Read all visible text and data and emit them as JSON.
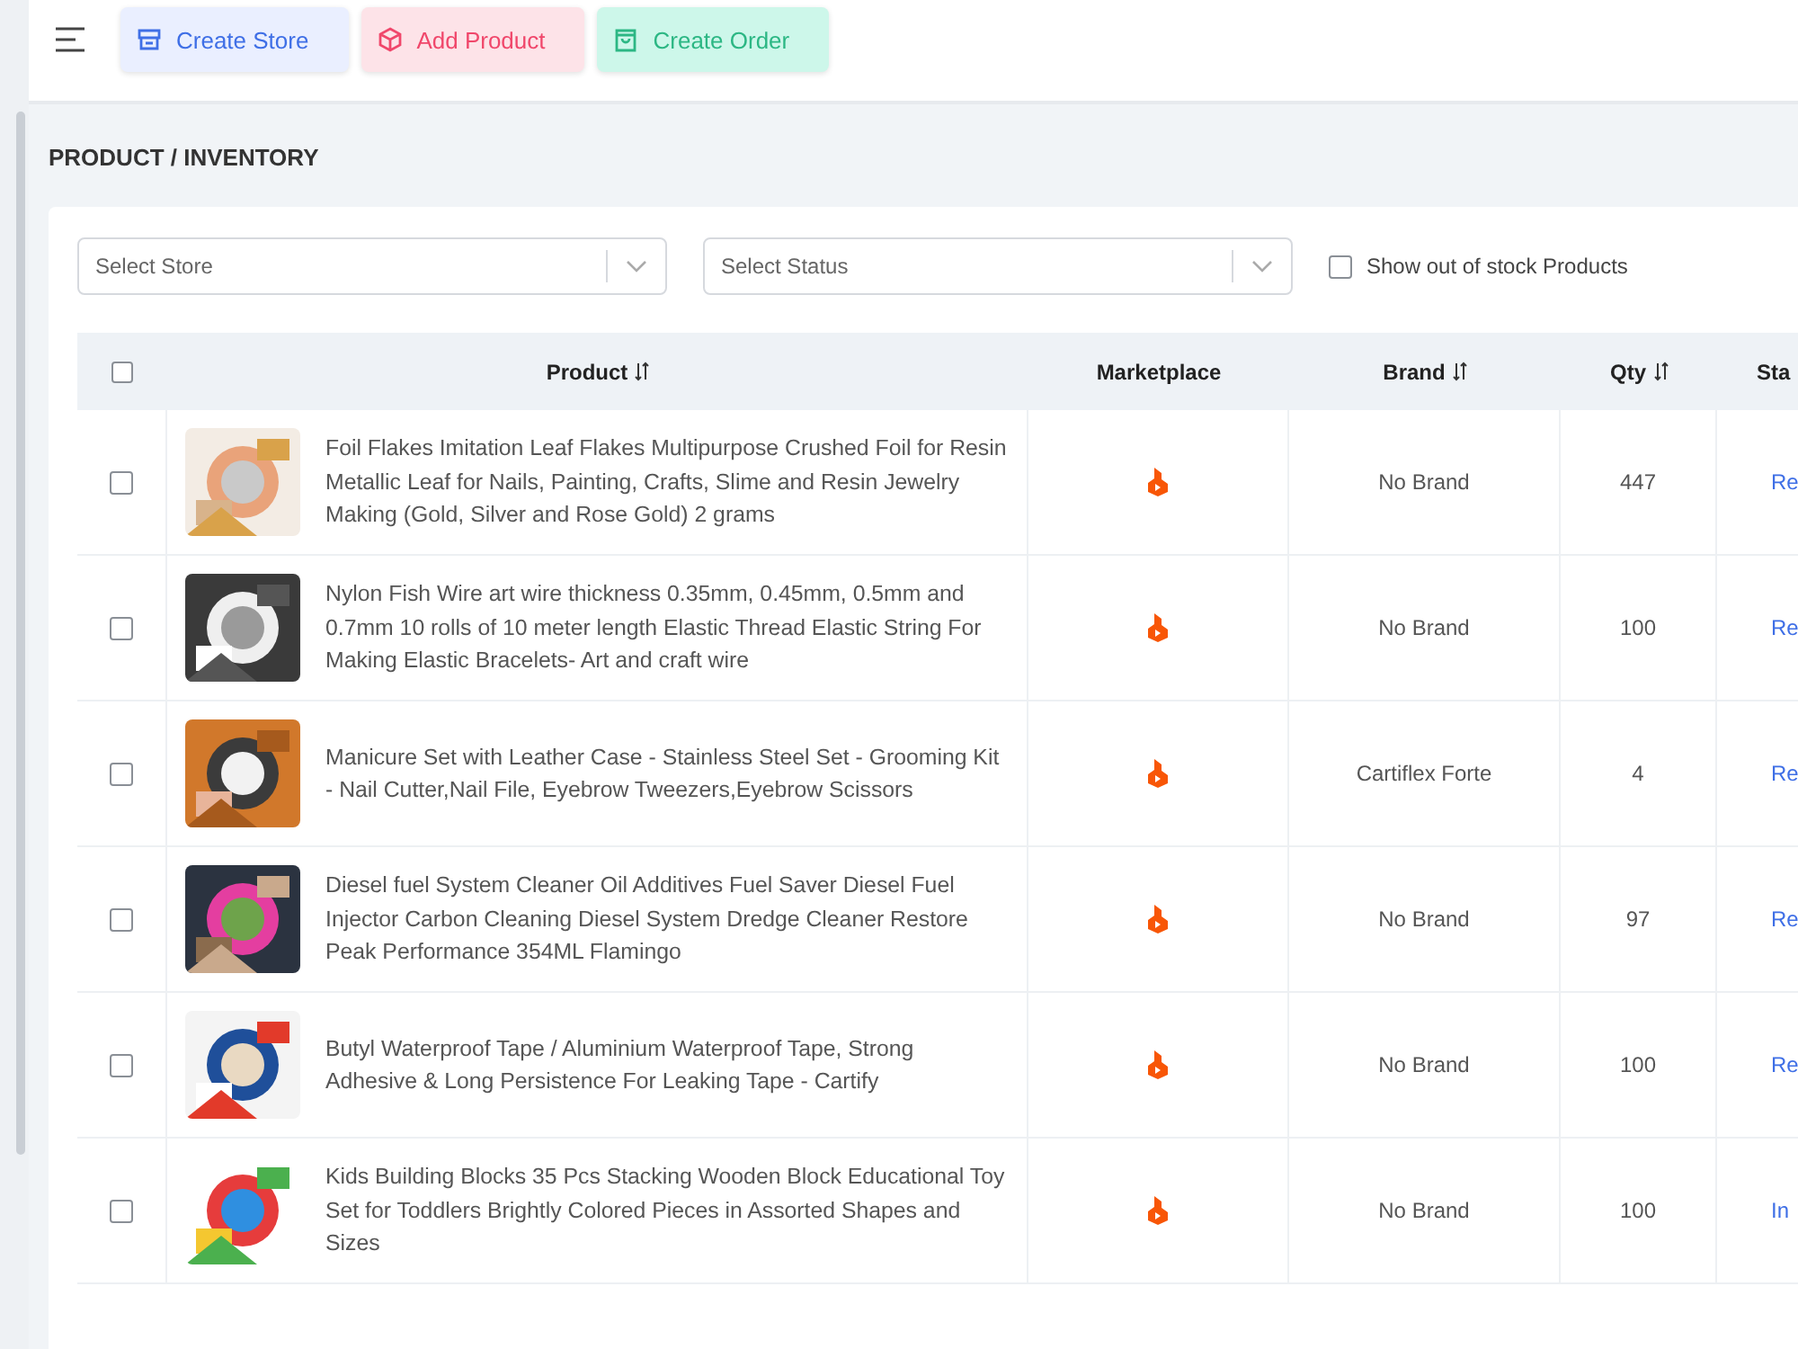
{
  "toolbar": {
    "buttons": [
      {
        "label": "Create Store",
        "kind": "store"
      },
      {
        "label": "Add Product",
        "kind": "product"
      },
      {
        "label": "Create Order",
        "kind": "order"
      }
    ]
  },
  "page_title": "PRODUCT / INVENTORY",
  "filters": {
    "selects": [
      {
        "placeholder": "Select Store"
      },
      {
        "placeholder": "Select Status"
      }
    ],
    "out_of_stock": {
      "label": "Show out of stock Products",
      "checked": false
    }
  },
  "table": {
    "select_all": {
      "checked": false
    },
    "columns": [
      {
        "label": "Product",
        "sortable": true
      },
      {
        "label": "Marketplace",
        "sortable": false
      },
      {
        "label": "Brand",
        "sortable": true
      },
      {
        "label": "Qty",
        "sortable": true
      },
      {
        "label": "Sta",
        "sortable": false
      }
    ],
    "rows": [
      {
        "checked": false,
        "product": "Foil Flakes Imitation Leaf Flakes Multipurpose Crushed Foil for Resin Metallic Leaf for Nails, Painting, Crafts, Slime and Resin Jewelry Making (Gold, Silver and Rose Gold) 2 grams",
        "brand": "No Brand",
        "qty": "447",
        "status": "Re"
      },
      {
        "checked": false,
        "product": "Nylon Fish Wire art wire thickness 0.35mm, 0.45mm, 0.5mm and 0.7mm 10 rolls of 10 meter length Elastic Thread Elastic String For Making Elastic Bracelets- Art and craft wire",
        "brand": "No Brand",
        "qty": "100",
        "status": "Re"
      },
      {
        "checked": false,
        "product": "Manicure Set with Leather Case - Stainless Steel Set - Grooming Kit - Nail Cutter,Nail File, Eyebrow Tweezers,Eyebrow Scissors",
        "brand": "Cartiflex Forte",
        "qty": "4",
        "status": "Re"
      },
      {
        "checked": false,
        "product": "Diesel fuel System Cleaner Oil Additives Fuel Saver Diesel Fuel Injector Carbon Cleaning Diesel System Dredge Cleaner Restore Peak Performance 354ML Flamingo",
        "brand": "No Brand",
        "qty": "97",
        "status": "Re"
      },
      {
        "checked": false,
        "product": "Butyl Waterproof Tape / Aluminium Waterproof Tape, Strong Adhesive & Long Persistence For Leaking Tape - Cartify",
        "brand": "No Brand",
        "qty": "100",
        "status": "Re"
      },
      {
        "checked": false,
        "product": "Kids Building Blocks 35 Pcs Stacking Wooden Block Educational Toy Set for Toddlers Brightly Colored Pieces in Assorted Shapes and Sizes",
        "brand": "No Brand",
        "qty": "100",
        "status": "In"
      }
    ]
  }
}
